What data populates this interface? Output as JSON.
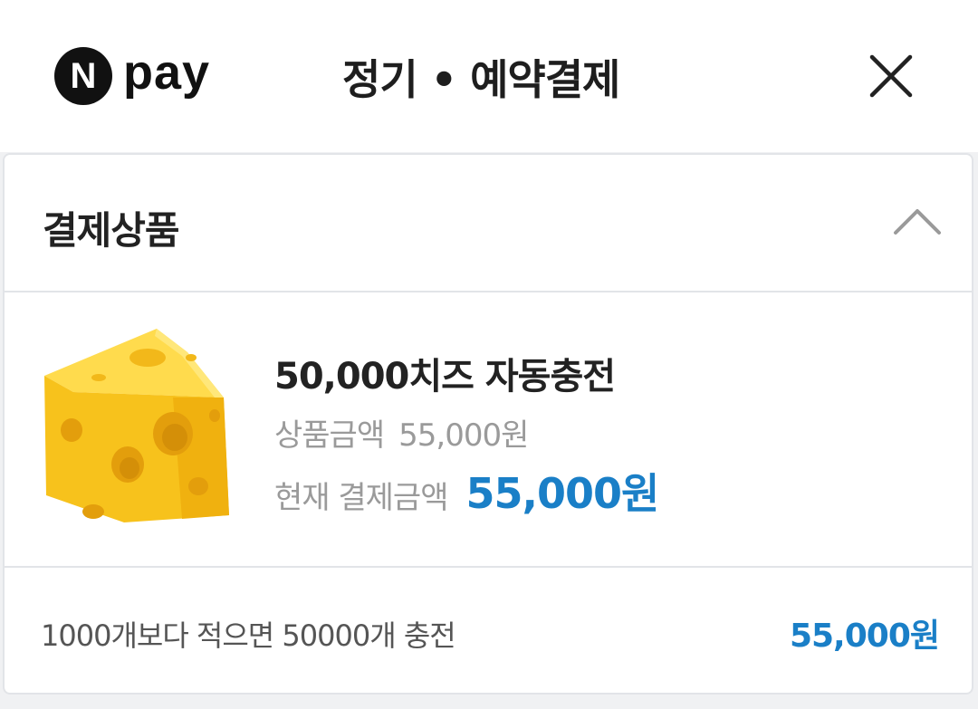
{
  "header": {
    "logo_n": "N",
    "logo_pay": "pay",
    "title": "정기 • 예약결제",
    "close_icon": "close-icon"
  },
  "section": {
    "title": "결제상품",
    "collapse_icon": "chevron-up-icon"
  },
  "product": {
    "image": "cheese-icon",
    "name": "50,000치즈 자동충전",
    "price_label": "상품금액",
    "price_value": "55,000원",
    "current_label": "현재 결제금액",
    "current_value": "55,000원"
  },
  "condition": {
    "text": "1000개보다 적으면 50000개 충전",
    "amount": "55,000원"
  },
  "colors": {
    "accent": "#1a7fc7",
    "cheese": "#f7c21c"
  }
}
